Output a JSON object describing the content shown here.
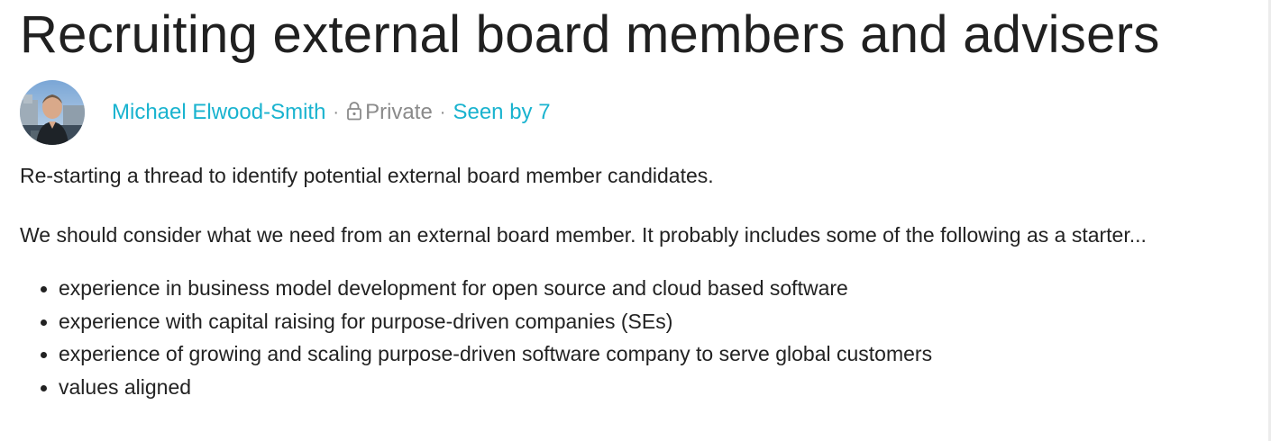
{
  "post": {
    "title": "Recruiting external board members and advisers",
    "author": "Michael Elwood-Smith",
    "separator": "·",
    "visibility": "Private",
    "seen_by": "Seen by 7",
    "paragraphs": [
      "Re-starting a thread to identify potential external board member candidates.",
      "We should consider what we need from an external board member. It probably includes some of the following as a starter..."
    ],
    "criteria": [
      "experience in business model development for open source and cloud based software",
      "experience with capital raising for purpose-driven companies (SEs)",
      "experience of growing and scaling purpose-driven software company to serve global customers",
      "values aligned"
    ]
  },
  "icons": {
    "avatar": "author-avatar",
    "privacy": "lock-icon"
  },
  "colors": {
    "link": "#19b3cf",
    "muted": "#8a8a8a",
    "text": "#222222",
    "title": "#202020"
  }
}
